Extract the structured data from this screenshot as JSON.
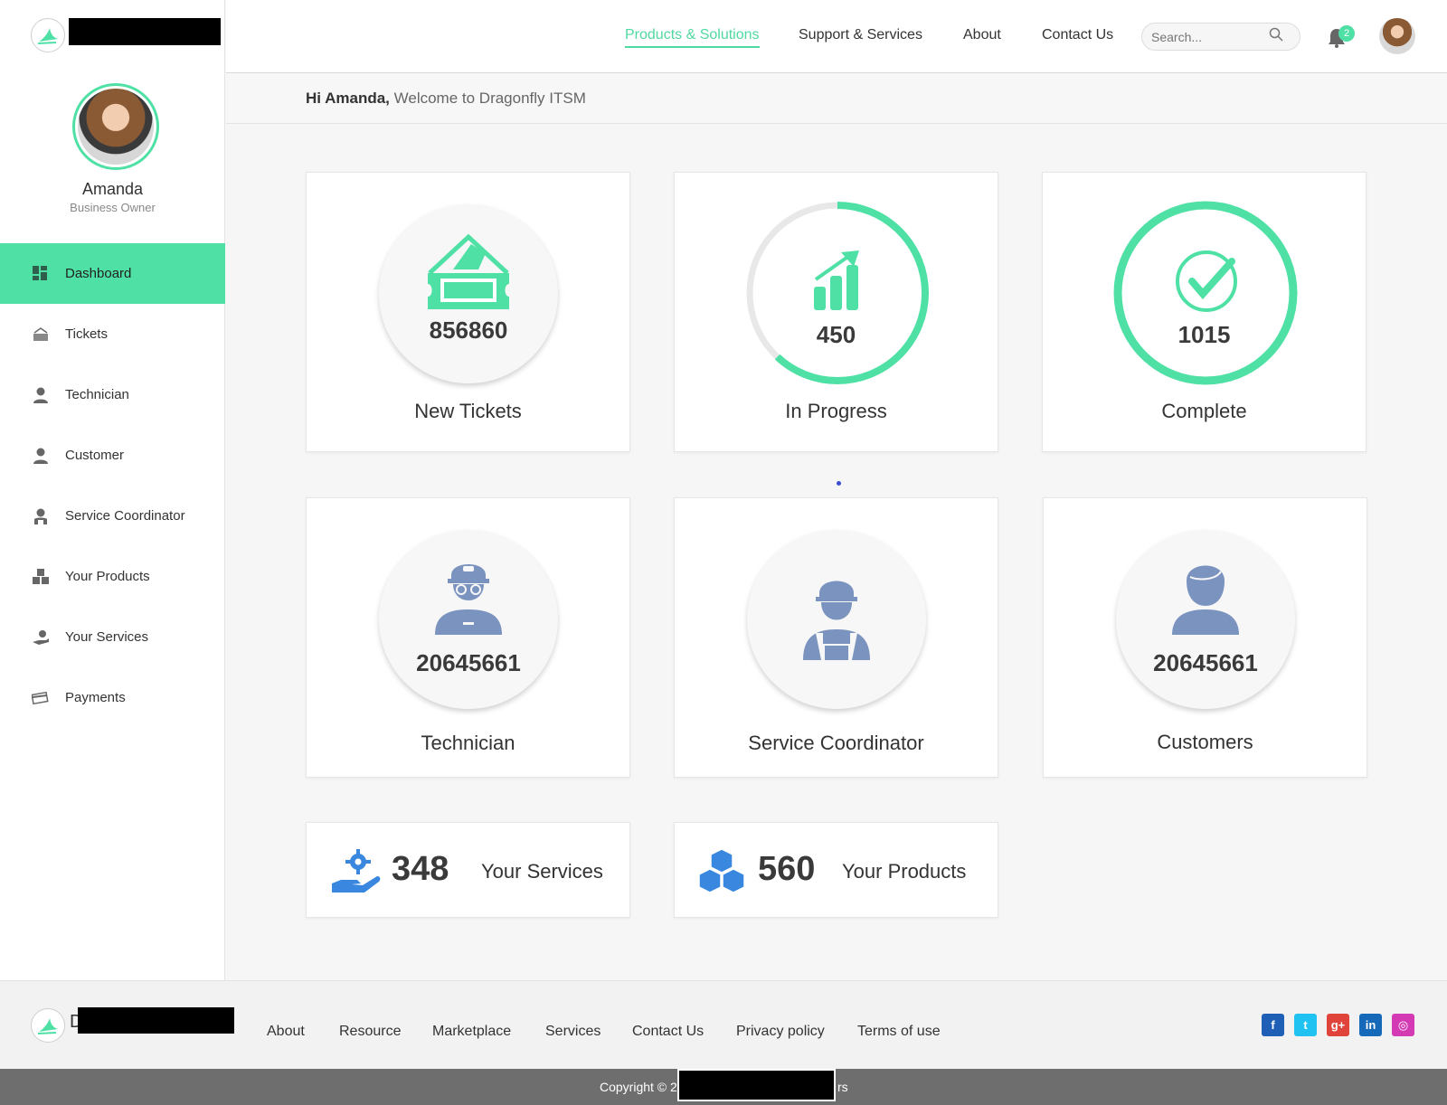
{
  "brand": {
    "accent": "#4fe0a5",
    "icon_blue": "#7b93bf",
    "bright_blue": "#3a87df"
  },
  "header": {
    "nav": [
      {
        "label": "Products & Solutions",
        "active": true
      },
      {
        "label": "Support & Services"
      },
      {
        "label": "About"
      },
      {
        "label": "Contact Us"
      }
    ],
    "search_placeholder": "Search...",
    "notification_count": "2"
  },
  "sidebar": {
    "profile": {
      "name": "Amanda",
      "role": "Business Owner"
    },
    "items": [
      {
        "label": "Dashboard",
        "icon": "dashboard-icon",
        "active": true
      },
      {
        "label": "Tickets",
        "icon": "ticket-icon"
      },
      {
        "label": "Technician",
        "icon": "technician-icon"
      },
      {
        "label": "Customer",
        "icon": "customer-icon"
      },
      {
        "label": "Service Coordinator",
        "icon": "service-coordinator-icon"
      },
      {
        "label": "Your Products",
        "icon": "products-icon"
      },
      {
        "label": "Your Services",
        "icon": "services-icon"
      },
      {
        "label": "Payments",
        "icon": "payments-icon"
      }
    ]
  },
  "welcome": {
    "greeting": "Hi Amanda,",
    "message": "Welcome to Dragonfly ITSM"
  },
  "stats": {
    "new_tickets": {
      "value": "856860",
      "label": "New Tickets"
    },
    "in_progress": {
      "value": "450",
      "label": "In Progress",
      "progress": 0.62
    },
    "complete": {
      "value": "1015",
      "label": "Complete",
      "progress": 1.0
    },
    "technician": {
      "value": "20645661",
      "label": "Technician"
    },
    "service_coordinator": {
      "label": "Service Coordinator"
    },
    "customers": {
      "value": "20645661",
      "label": "Customers"
    },
    "your_services": {
      "value": "348",
      "label": "Your Services"
    },
    "your_products": {
      "value": "560",
      "label": "Your Products"
    }
  },
  "footer": {
    "logo_initial": "D",
    "links": [
      "About",
      "Resource",
      "Marketplace",
      "Services",
      "Contact Us",
      "Privacy policy",
      "Terms of use"
    ],
    "social": [
      "facebook-icon",
      "twitter-icon",
      "google-plus-icon",
      "linkedin-icon",
      "instagram-icon"
    ],
    "copyright_prefix": "Copyright © 2",
    "copyright_suffix": "rs"
  }
}
